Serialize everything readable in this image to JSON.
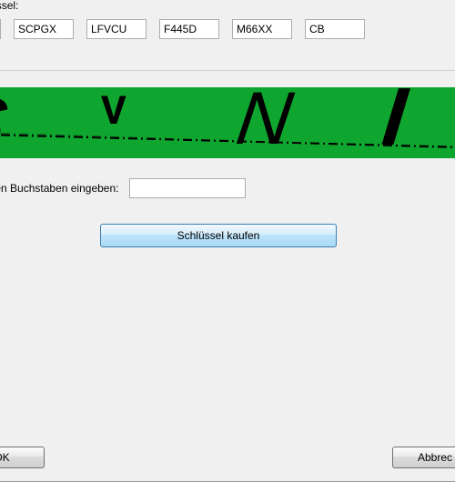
{
  "labels": {
    "keyLabel": "gsschlüssel:",
    "captchaPrompt": "ier obigen Buchstaben eingeben:"
  },
  "keys": {
    "k0": "",
    "k1": "SCPGX",
    "k2": "LFVCU",
    "k3": "F445D",
    "k4": "M66XX",
    "k5": "CB"
  },
  "captcha": {
    "c0": "S",
    "c1": "V",
    "c2": "N",
    "c3": "I",
    "value": ""
  },
  "buttons": {
    "buy": "Schlüssel kaufen",
    "ok": "OK",
    "cancel": "Abbrec"
  }
}
